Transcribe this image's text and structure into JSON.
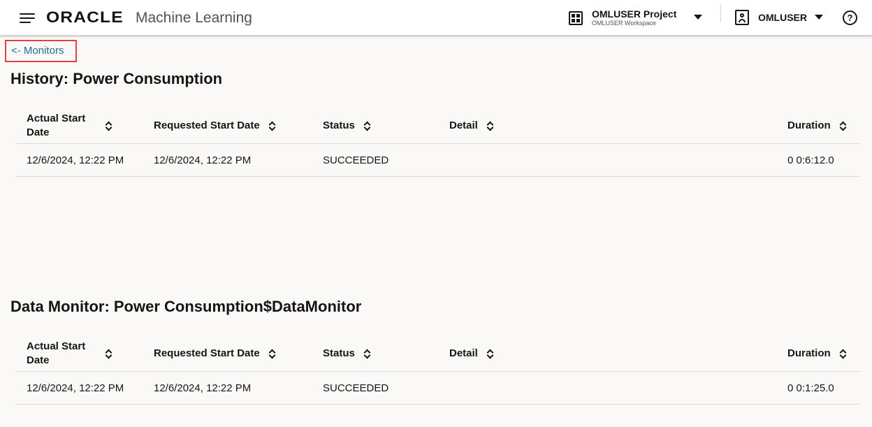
{
  "header": {
    "logo_brand": "ORACLE",
    "logo_product": "Machine Learning",
    "project_name": "OMLUSER Project",
    "workspace_name": "OMLUSER Workspace",
    "user_name": "OMLUSER",
    "help_glyph": "?"
  },
  "back_link": "<- Monitors",
  "columns": [
    "Actual Start Date",
    "Requested Start Date",
    "Status",
    "Detail",
    "Duration"
  ],
  "sections": [
    {
      "title": "History: Power Consumption",
      "rows": [
        {
          "actual_start": "12/6/2024, 12:22 PM",
          "requested_start": "12/6/2024, 12:22 PM",
          "status": "SUCCEEDED",
          "detail": "",
          "duration": "0 0:6:12.0"
        }
      ]
    },
    {
      "title": "Data Monitor: Power Consumption$DataMonitor",
      "rows": [
        {
          "actual_start": "12/6/2024, 12:22 PM",
          "requested_start": "12/6/2024, 12:22 PM",
          "status": "SUCCEEDED",
          "detail": "",
          "duration": "0 0:1:25.0"
        }
      ]
    }
  ],
  "icons": {
    "menu": "hamburger-menu-icon",
    "project": "grid-icon",
    "user": "user-avatar-icon",
    "help": "help-icon",
    "sort": "sort-icon"
  },
  "colors": {
    "link": "#1b6f8a",
    "focus_outline": "#e0403f",
    "background": "#faf9f8"
  }
}
